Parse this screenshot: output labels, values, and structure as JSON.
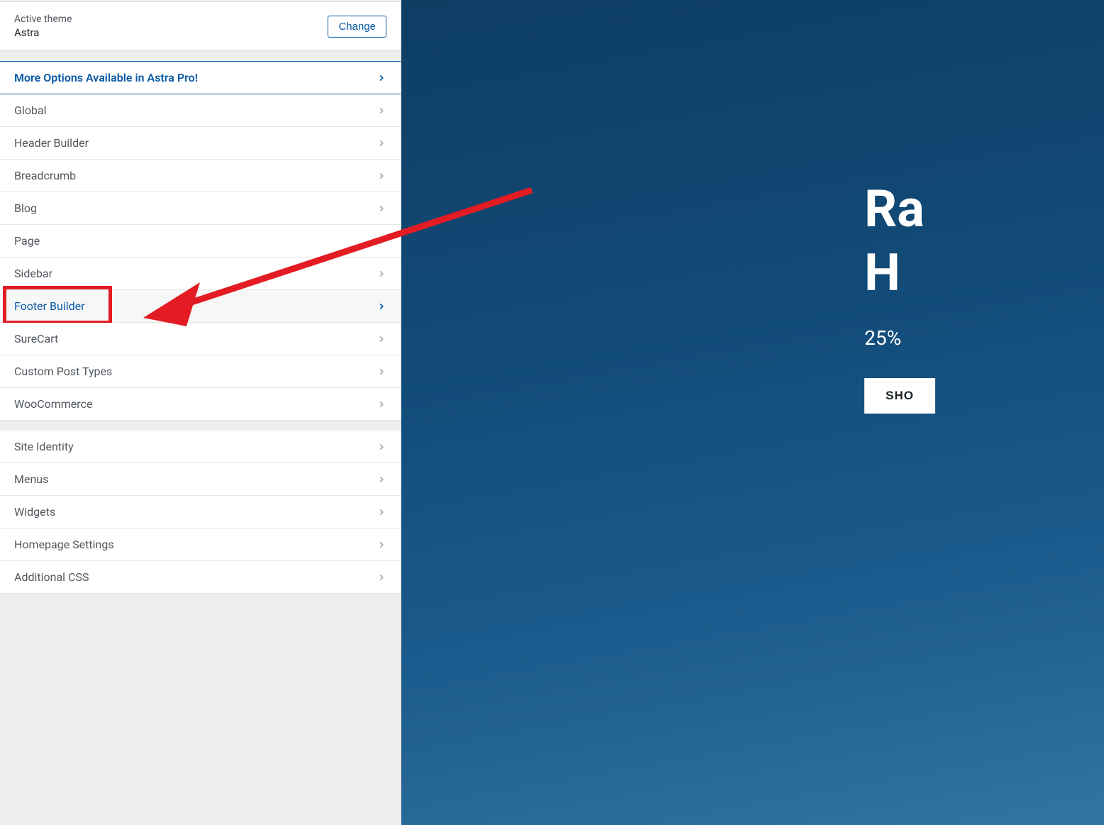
{
  "header": {
    "active_theme_label": "Active theme",
    "theme_name": "Astra",
    "change_button": "Change"
  },
  "sections": {
    "pro_cta": "More Options Available in Astra Pro!",
    "group1": [
      "Global",
      "Header Builder",
      "Breadcrumb",
      "Blog",
      "Page",
      "Sidebar",
      "Footer Builder",
      "SureCart",
      "Custom Post Types",
      "WooCommerce"
    ],
    "group2": [
      "Site Identity",
      "Menus",
      "Widgets",
      "Homepage Settings",
      "Additional CSS"
    ],
    "active_index": 6
  },
  "preview": {
    "hero_line1": "Ra",
    "hero_line2": "H",
    "subtitle": "25%",
    "button": "SHO"
  },
  "annotation": {
    "arrow_color": "#e31b23"
  }
}
